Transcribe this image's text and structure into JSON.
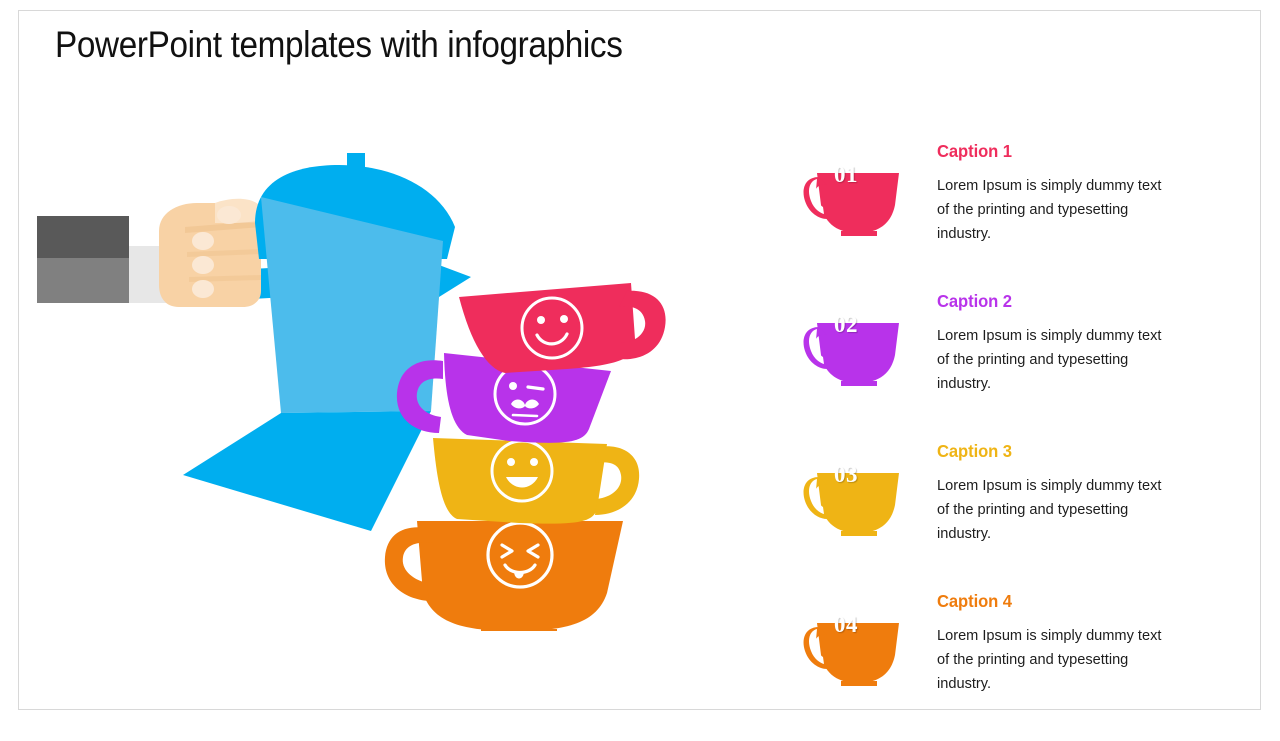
{
  "slide": {
    "title": "PowerPoint templates with infographics",
    "background": "#ffffff",
    "border_color": "#d8d8d8"
  },
  "illustration": {
    "name": "hand-pouring-moka-pot-with-stacked-cups",
    "pot": {
      "body_light": "#4CBCEC",
      "body_dark": "#00AEEF",
      "lid": "#00AEEF",
      "spout": "#00AEEF",
      "handle": "#00AEEF"
    },
    "arm": {
      "sleeve_dark": "#595959",
      "sleeve_mid": "#808080",
      "cuff": "#e7e7e7",
      "wrist": "#d9c6a5",
      "skin": "#F8D2A5",
      "skin_light": "#FBE3C7",
      "nail": "#FAEBD9"
    },
    "stacked_cups": [
      {
        "color": "#EF2D5C",
        "face": "smiley-face",
        "handle_side": "right"
      },
      {
        "color": "#B833EA",
        "face": "winking-mustache-face",
        "handle_side": "left"
      },
      {
        "color": "#EFB415",
        "face": "grinning-face",
        "handle_side": "right"
      },
      {
        "color": "#EF7C0D",
        "face": "squinting-tongue-face",
        "handle_side": "left"
      }
    ]
  },
  "captions": [
    {
      "number": "01",
      "heading": "Caption 1",
      "body": "Lorem Ipsum is simply dummy text of the printing and typesetting industry.",
      "color": "#EF2D5C",
      "icon": "coffee-cup-icon"
    },
    {
      "number": "02",
      "heading": "Caption 2",
      "body": "Lorem Ipsum is simply dummy text of the printing and typesetting industry.",
      "color": "#B833EA",
      "icon": "coffee-cup-icon"
    },
    {
      "number": "03",
      "heading": "Caption 3",
      "body": "Lorem Ipsum is simply dummy text of the printing and typesetting industry.",
      "color": "#EFB415",
      "icon": "coffee-cup-icon"
    },
    {
      "number": "04",
      "heading": "Caption 4",
      "body": "Lorem Ipsum is simply dummy text of the printing and typesetting industry.",
      "color": "#EF7C0D",
      "icon": "coffee-cup-icon"
    }
  ]
}
